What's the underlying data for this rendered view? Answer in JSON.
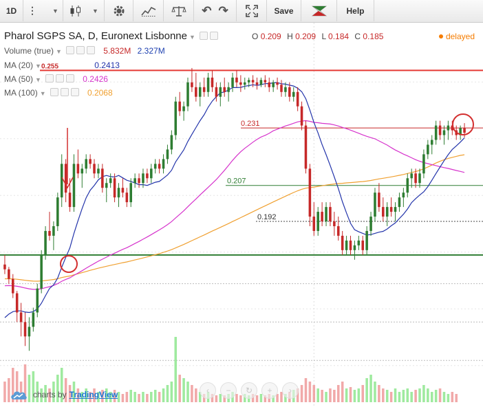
{
  "toolbar": {
    "interval": "1D",
    "save_label": "Save",
    "help_label": "Help"
  },
  "legend": {
    "symbol": "Pharol SGPS SA, D, Euronext Lisbonne",
    "ohlc": {
      "o_label": "O",
      "o": "0.209",
      "h_label": "H",
      "h": "0.209",
      "l_label": "L",
      "l": "0.184",
      "c_label": "C",
      "c": "0.185"
    },
    "status": "delayed",
    "volume": {
      "label": "Volume (true)",
      "v1": "5.832M",
      "v2": "2.327M"
    },
    "ma20": {
      "label": "MA (20)",
      "value": "0.2413"
    },
    "ma50": {
      "label": "MA (50)",
      "value": "0.2426"
    },
    "ma100": {
      "label": "MA (100)",
      "value": "0.2068"
    }
  },
  "colors": {
    "up": "#2e7d32",
    "down": "#c62828",
    "ma20": "#2233aa",
    "ma50": "#d633cc",
    "ma100": "#f0a030",
    "volume_up": "#8ee68e",
    "volume_down": "#ef9a9a"
  },
  "chart_data": {
    "type": "candlestick",
    "price_range": [
      0.12,
      0.262
    ],
    "ohlc": [
      [
        0.174,
        0.178,
        0.17,
        0.172
      ],
      [
        0.172,
        0.173,
        0.166,
        0.168
      ],
      [
        0.168,
        0.17,
        0.16,
        0.162
      ],
      [
        0.162,
        0.163,
        0.15,
        0.154
      ],
      [
        0.154,
        0.158,
        0.144,
        0.15
      ],
      [
        0.15,
        0.154,
        0.14,
        0.144
      ],
      [
        0.144,
        0.152,
        0.138,
        0.148
      ],
      [
        0.148,
        0.156,
        0.146,
        0.154
      ],
      [
        0.154,
        0.166,
        0.152,
        0.164
      ],
      [
        0.164,
        0.18,
        0.162,
        0.178
      ],
      [
        0.178,
        0.19,
        0.176,
        0.188
      ],
      [
        0.188,
        0.196,
        0.184,
        0.186
      ],
      [
        0.186,
        0.192,
        0.18,
        0.19
      ],
      [
        0.19,
        0.204,
        0.188,
        0.202
      ],
      [
        0.202,
        0.22,
        0.198,
        0.216
      ],
      [
        0.216,
        0.218,
        0.2,
        0.204
      ],
      [
        0.204,
        0.21,
        0.196,
        0.198
      ],
      [
        0.198,
        0.22,
        0.196,
        0.216
      ],
      [
        0.216,
        0.222,
        0.21,
        0.212
      ],
      [
        0.212,
        0.216,
        0.206,
        0.214
      ],
      [
        0.214,
        0.22,
        0.212,
        0.218
      ],
      [
        0.218,
        0.22,
        0.214,
        0.216
      ],
      [
        0.216,
        0.218,
        0.21,
        0.212
      ],
      [
        0.212,
        0.216,
        0.21,
        0.214
      ],
      [
        0.214,
        0.216,
        0.204,
        0.206
      ],
      [
        0.206,
        0.21,
        0.2,
        0.208
      ],
      [
        0.208,
        0.212,
        0.206,
        0.21
      ],
      [
        0.21,
        0.212,
        0.2,
        0.202
      ],
      [
        0.202,
        0.208,
        0.198,
        0.206
      ],
      [
        0.206,
        0.21,
        0.202,
        0.204
      ],
      [
        0.204,
        0.206,
        0.198,
        0.2
      ],
      [
        0.2,
        0.21,
        0.198,
        0.208
      ],
      [
        0.208,
        0.212,
        0.206,
        0.21
      ],
      [
        0.21,
        0.212,
        0.206,
        0.208
      ],
      [
        0.208,
        0.214,
        0.206,
        0.212
      ],
      [
        0.212,
        0.214,
        0.208,
        0.21
      ],
      [
        0.21,
        0.216,
        0.208,
        0.214
      ],
      [
        0.214,
        0.218,
        0.212,
        0.216
      ],
      [
        0.216,
        0.218,
        0.212,
        0.214
      ],
      [
        0.214,
        0.22,
        0.212,
        0.218
      ],
      [
        0.218,
        0.224,
        0.216,
        0.222
      ],
      [
        0.222,
        0.23,
        0.22,
        0.228
      ],
      [
        0.228,
        0.244,
        0.226,
        0.242
      ],
      [
        0.242,
        0.246,
        0.236,
        0.238
      ],
      [
        0.238,
        0.242,
        0.234,
        0.24
      ],
      [
        0.24,
        0.252,
        0.238,
        0.25
      ],
      [
        0.25,
        0.256,
        0.246,
        0.248
      ],
      [
        0.248,
        0.254,
        0.242,
        0.244
      ],
      [
        0.244,
        0.25,
        0.24,
        0.248
      ],
      [
        0.248,
        0.252,
        0.244,
        0.246
      ],
      [
        0.246,
        0.254,
        0.244,
        0.252
      ],
      [
        0.252,
        0.255,
        0.246,
        0.248
      ],
      [
        0.248,
        0.25,
        0.242,
        0.244
      ],
      [
        0.244,
        0.25,
        0.24,
        0.248
      ],
      [
        0.248,
        0.252,
        0.244,
        0.246
      ],
      [
        0.246,
        0.25,
        0.242,
        0.248
      ],
      [
        0.248,
        0.254,
        0.246,
        0.252
      ],
      [
        0.252,
        0.255,
        0.248,
        0.25
      ],
      [
        0.25,
        0.253,
        0.246,
        0.249
      ],
      [
        0.249,
        0.252,
        0.247,
        0.25
      ],
      [
        0.25,
        0.252,
        0.248,
        0.251
      ],
      [
        0.251,
        0.253,
        0.248,
        0.25
      ],
      [
        0.25,
        0.252,
        0.247,
        0.249
      ],
      [
        0.249,
        0.252,
        0.248,
        0.251
      ],
      [
        0.251,
        0.253,
        0.248,
        0.25
      ],
      [
        0.25,
        0.252,
        0.246,
        0.248
      ],
      [
        0.248,
        0.251,
        0.246,
        0.25
      ],
      [
        0.25,
        0.252,
        0.247,
        0.249
      ],
      [
        0.249,
        0.251,
        0.244,
        0.246
      ],
      [
        0.246,
        0.25,
        0.244,
        0.248
      ],
      [
        0.248,
        0.25,
        0.242,
        0.244
      ],
      [
        0.244,
        0.248,
        0.242,
        0.246
      ],
      [
        0.246,
        0.248,
        0.238,
        0.24
      ],
      [
        0.24,
        0.242,
        0.23,
        0.232
      ],
      [
        0.232,
        0.234,
        0.212,
        0.214
      ],
      [
        0.214,
        0.216,
        0.19,
        0.194
      ],
      [
        0.194,
        0.2,
        0.186,
        0.188
      ],
      [
        0.188,
        0.198,
        0.186,
        0.196
      ],
      [
        0.196,
        0.2,
        0.19,
        0.192
      ],
      [
        0.192,
        0.2,
        0.19,
        0.198
      ],
      [
        0.198,
        0.2,
        0.19,
        0.192
      ],
      [
        0.192,
        0.196,
        0.186,
        0.19
      ],
      [
        0.19,
        0.194,
        0.184,
        0.186
      ],
      [
        0.186,
        0.188,
        0.178,
        0.18
      ],
      [
        0.18,
        0.186,
        0.178,
        0.184
      ],
      [
        0.184,
        0.186,
        0.178,
        0.18
      ],
      [
        0.18,
        0.184,
        0.176,
        0.182
      ],
      [
        0.182,
        0.186,
        0.18,
        0.184
      ],
      [
        0.184,
        0.186,
        0.178,
        0.18
      ],
      [
        0.18,
        0.19,
        0.178,
        0.188
      ],
      [
        0.188,
        0.196,
        0.186,
        0.194
      ],
      [
        0.194,
        0.206,
        0.192,
        0.204
      ],
      [
        0.204,
        0.208,
        0.196,
        0.198
      ],
      [
        0.198,
        0.202,
        0.192,
        0.194
      ],
      [
        0.194,
        0.2,
        0.19,
        0.198
      ],
      [
        0.198,
        0.202,
        0.194,
        0.196
      ],
      [
        0.196,
        0.2,
        0.192,
        0.198
      ],
      [
        0.198,
        0.204,
        0.196,
        0.202
      ],
      [
        0.202,
        0.206,
        0.198,
        0.204
      ],
      [
        0.204,
        0.212,
        0.202,
        0.21
      ],
      [
        0.21,
        0.214,
        0.206,
        0.212
      ],
      [
        0.212,
        0.214,
        0.206,
        0.208
      ],
      [
        0.208,
        0.214,
        0.206,
        0.212
      ],
      [
        0.212,
        0.222,
        0.21,
        0.22
      ],
      [
        0.22,
        0.226,
        0.218,
        0.224
      ],
      [
        0.224,
        0.228,
        0.22,
        0.226
      ],
      [
        0.226,
        0.234,
        0.224,
        0.232
      ],
      [
        0.232,
        0.234,
        0.226,
        0.228
      ],
      [
        0.228,
        0.232,
        0.224,
        0.23
      ],
      [
        0.23,
        0.234,
        0.226,
        0.232
      ],
      [
        0.232,
        0.234,
        0.228,
        0.23
      ],
      [
        0.23,
        0.232,
        0.226,
        0.228
      ],
      [
        0.228,
        0.232,
        0.226,
        0.231
      ],
      [
        0.231,
        0.233,
        0.227,
        0.229
      ]
    ],
    "levels": [
      0.255,
      0.231,
      0.207,
      0.192
    ],
    "volume": [
      0.3,
      0.35,
      0.5,
      0.45,
      0.3,
      0.55,
      0.4,
      0.45,
      0.3,
      0.2,
      0.25,
      0.2,
      0.3,
      0.4,
      0.5,
      0.35,
      0.25,
      0.3,
      0.2,
      0.15,
      0.2,
      0.15,
      0.2,
      0.15,
      0.18,
      0.2,
      0.15,
      0.18,
      0.15,
      0.12,
      0.15,
      0.18,
      0.15,
      0.12,
      0.15,
      0.12,
      0.15,
      0.18,
      0.15,
      0.2,
      0.25,
      0.3,
      0.95,
      0.4,
      0.35,
      0.3,
      0.25,
      0.2,
      0.15,
      0.12,
      0.15,
      0.12,
      0.1,
      0.12,
      0.1,
      0.12,
      0.15,
      0.12,
      0.1,
      0.12,
      0.1,
      0.12,
      0.1,
      0.12,
      0.1,
      0.12,
      0.1,
      0.12,
      0.15,
      0.12,
      0.15,
      0.18,
      0.2,
      0.25,
      0.35,
      0.3,
      0.25,
      0.2,
      0.18,
      0.15,
      0.2,
      0.18,
      0.25,
      0.3,
      0.2,
      0.22,
      0.18,
      0.2,
      0.25,
      0.35,
      0.4,
      0.3,
      0.25,
      0.2,
      0.18,
      0.15,
      0.2,
      0.15,
      0.18,
      0.2,
      0.15,
      0.18,
      0.2,
      0.25,
      0.2,
      0.15,
      0.18,
      0.2,
      0.15,
      0.12,
      0.15,
      0.12
    ]
  },
  "branding": {
    "prefix": "charts by",
    "name": "TradingView"
  }
}
